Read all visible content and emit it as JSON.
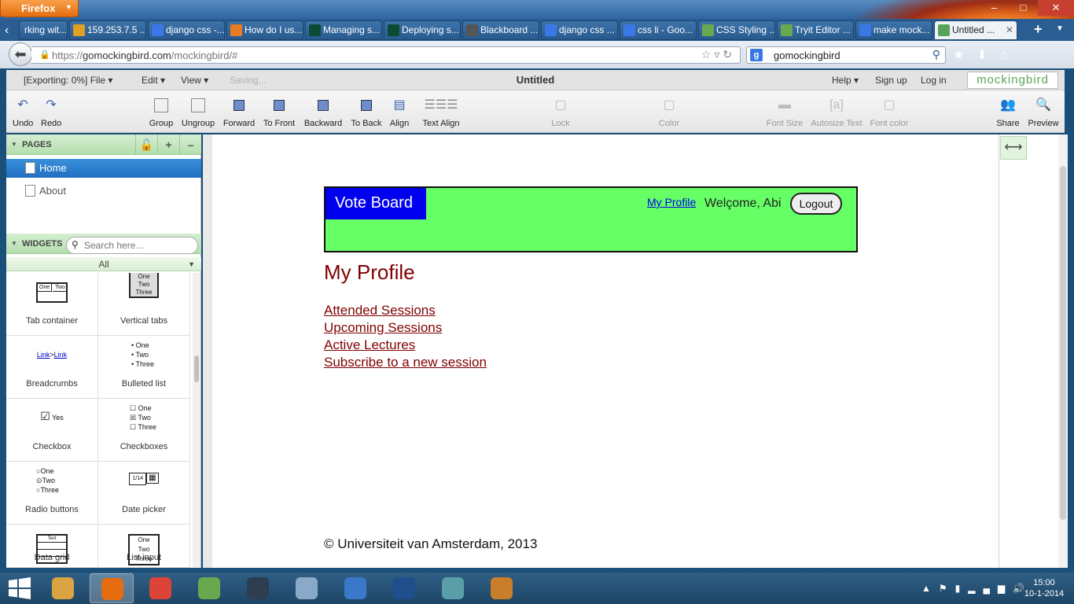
{
  "browser": {
    "menu_label": "Firefox",
    "window_controls": [
      "–",
      "□",
      "✕"
    ],
    "tabs": [
      {
        "label": "rking wit...",
        "icon": "tab-scroll-back",
        "color": "#2a5d92"
      },
      {
        "label": "159.253.7.5 ...",
        "icon": "warning-icon",
        "color": "#e0a020"
      },
      {
        "label": "django css -...",
        "icon": "google-icon",
        "color": "#3b78e7"
      },
      {
        "label": "How do I us...",
        "icon": "stackoverflow-icon",
        "color": "#e87c22"
      },
      {
        "label": "Managing s...",
        "icon": "django-icon",
        "color": "#0c4b33"
      },
      {
        "label": "Deploying s...",
        "icon": "django-icon",
        "color": "#0c4b33"
      },
      {
        "label": "Blackboard ...",
        "icon": "blackboard-icon",
        "color": "#555555"
      },
      {
        "label": "django css ...",
        "icon": "google-icon",
        "color": "#3b78e7"
      },
      {
        "label": "css li - Goo...",
        "icon": "google-icon",
        "color": "#3b78e7"
      },
      {
        "label": "CSS Styling ...",
        "icon": "w3schools-icon",
        "color": "#6aa84f"
      },
      {
        "label": "Tryit Editor ...",
        "icon": "w3schools-icon",
        "color": "#6aa84f"
      },
      {
        "label": "make mock...",
        "icon": "google-icon",
        "color": "#3b78e7"
      },
      {
        "label": "Untitled ...",
        "icon": "mockingbird-icon",
        "color": "#5aa25a",
        "active": true
      }
    ],
    "url_prefix": "https://",
    "url_domain": "gomockingbird.com",
    "url_path": "/mockingbird/#",
    "search_value": "gomockingbird"
  },
  "app": {
    "menus": {
      "file": "[Exporting: 0%] File ▾",
      "edit": "Edit ▾",
      "view": "View ▾",
      "saving": "Saving..."
    },
    "title": "Untitled",
    "right_menus": {
      "help": "Help ▾",
      "signup": "Sign up",
      "login": "Log in"
    },
    "logo": "mockingbird",
    "toolbar": {
      "undo": "Undo",
      "redo": "Redo",
      "group": "Group",
      "ungroup": "Ungroup",
      "forward": "Forward",
      "to_front": "To Front",
      "backward": "Backward",
      "to_back": "To Back",
      "align": "Align",
      "text_align": "Text Align",
      "lock": "Lock",
      "color": "Color",
      "font_size": "Font Size",
      "autosize": "Autosize Text",
      "font_color": "Font color",
      "share": "Share",
      "preview": "Preview"
    },
    "pages_header": "PAGES",
    "pages": [
      {
        "label": "Home",
        "selected": true
      },
      {
        "label": "About",
        "selected": false
      }
    ],
    "widgets_header": "WIDGETS",
    "widget_search_placeholder": "Search here...",
    "widget_filter": "All",
    "widgets": [
      {
        "label": "Tab container"
      },
      {
        "label": "Vertical tabs"
      },
      {
        "label": "Breadcrumbs"
      },
      {
        "label": "Bulleted list"
      },
      {
        "label": "Checkbox"
      },
      {
        "label": "Checkboxes"
      },
      {
        "label": "Radio buttons"
      },
      {
        "label": "Date picker"
      },
      {
        "label": "Data grid"
      },
      {
        "label": "List input"
      }
    ],
    "widget_previews": {
      "tab_one": "One",
      "tab_two": "Two",
      "vt_one": "One",
      "vt_two": "Two",
      "vt_three": "Three",
      "crumb_a": "Link",
      "crumb_b": "Link",
      "b_one": "• One",
      "b_two": "• Two",
      "b_three": "• Three",
      "cb_yes": "Yes",
      "cbs_one": "One",
      "cbs_two": "Two",
      "cbs_three": "Three",
      "r_one": "One",
      "r_two": "Two",
      "r_three": "Three",
      "date": "1/14",
      "grid": "Text",
      "li_one": "One",
      "li_two": "Two",
      "li_three": "Three"
    }
  },
  "mockup": {
    "brand": "Vote Board",
    "header_link": "My Profile",
    "welcome": "Welçome, Abi",
    "logout": "Logout",
    "page_title": "My Profile",
    "links": [
      "Attended Sessions",
      "Upcoming Sessions",
      "Active Lectures",
      "Subscribe to a new session"
    ],
    "footer": "©  Universiteit van Amsterdam, 2013",
    "colors": {
      "header_bg": "#66ff66",
      "brand_bg": "#0000ee",
      "accent": "#800000"
    }
  },
  "taskbar": {
    "apps": [
      {
        "icon": "file-explorer-icon",
        "color": "#d9a441"
      },
      {
        "icon": "firefox-icon",
        "color": "#e56d10",
        "active": true
      },
      {
        "icon": "chrome-icon",
        "color": "#db4437"
      },
      {
        "icon": "utorrent-icon",
        "color": "#6aa84f"
      },
      {
        "icon": "app-icon",
        "color": "#2c3e50"
      },
      {
        "icon": "notepad-icon",
        "color": "#8aa9c9"
      },
      {
        "icon": "app-icon-blue",
        "color": "#3a78c9"
      },
      {
        "icon": "powershell-icon",
        "color": "#1f4e8c"
      },
      {
        "icon": "app-icon-green",
        "color": "#5a9ea8"
      },
      {
        "icon": "paint-icon",
        "color": "#c97e2b"
      }
    ],
    "time": "15:00",
    "date": "10-1-2014"
  }
}
